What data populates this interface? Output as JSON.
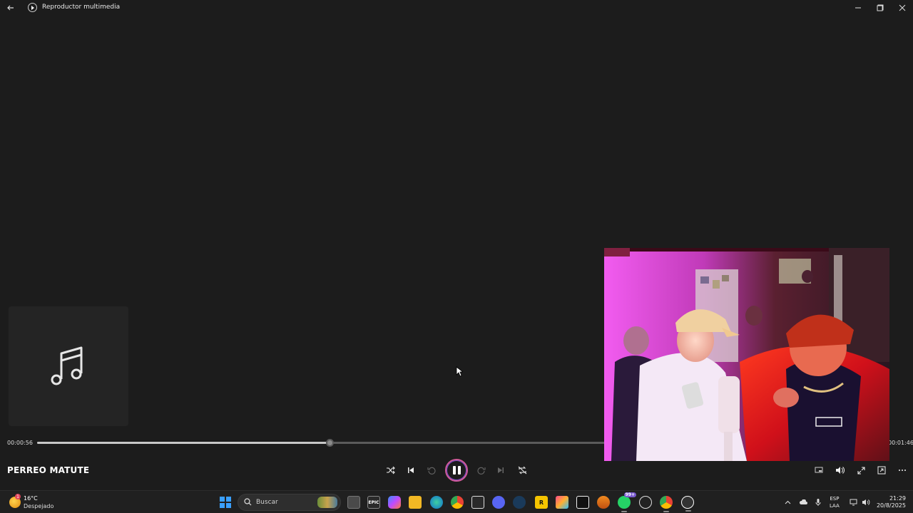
{
  "window": {
    "title": "Reproductor multimedia"
  },
  "player": {
    "current_time": "00:00:56",
    "total_time": "00:01:46",
    "progress": 0.345,
    "track_title": "PERREO MATUTE",
    "state": "playing"
  },
  "taskbar": {
    "weather_temp": "16°C",
    "weather_desc": "Despejado",
    "weather_badge": "1",
    "search_placeholder": "Buscar",
    "lang_line1": "ESP",
    "lang_line2": "LAA",
    "time": "21:29",
    "date": "20/8/2025",
    "whatsapp_badge": "99+"
  },
  "colors": {
    "background": "#1c1c1c",
    "accent_play_ring": "#d05a9a",
    "taskbar": "#202020"
  }
}
